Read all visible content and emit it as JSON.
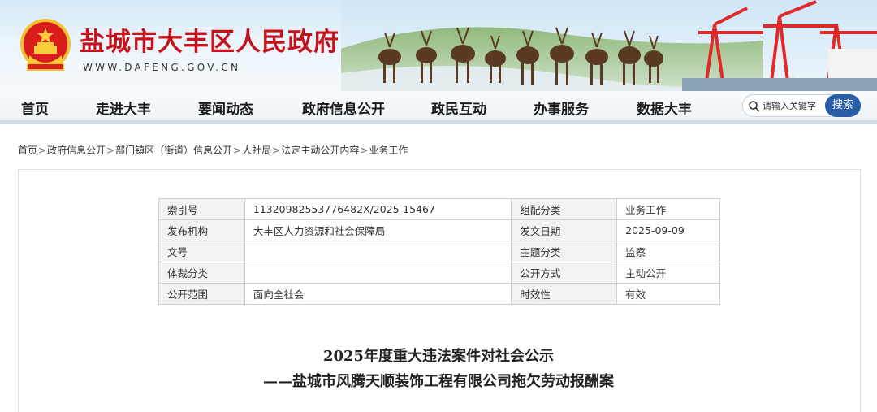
{
  "header": {
    "site_name": "盐城市大丰区人民政府",
    "site_url": "WWW.DAFENG.GOV.CN",
    "colors": {
      "brand_red": "#c6121a",
      "accent_blue": "#2a5ca8"
    }
  },
  "nav": {
    "items": [
      {
        "label": "首页"
      },
      {
        "label": "走进大丰"
      },
      {
        "label": "要闻动态"
      },
      {
        "label": "政府信息公开"
      },
      {
        "label": "政民互动"
      },
      {
        "label": "办事服务"
      },
      {
        "label": "数据大丰"
      }
    ],
    "search": {
      "placeholder": "请输入关键字",
      "button_label": "搜索",
      "icon": "search-icon"
    }
  },
  "breadcrumb": {
    "items": [
      "首页",
      "政府信息公开",
      "部门镇区（街道）信息公开",
      "人社局",
      "法定主动公开内容",
      "业务工作"
    ],
    "separator": ">"
  },
  "meta_table": {
    "rows": [
      {
        "k1": "索引号",
        "v1": "11320982553776482X/2025-15467",
        "k2": "组配分类",
        "v2": "业务工作"
      },
      {
        "k1": "发布机构",
        "v1": "大丰区人力资源和社会保障局",
        "k2": "发文日期",
        "v2": "2025-09-09"
      },
      {
        "k1": "文号",
        "v1": "",
        "k2": "主题分类",
        "v2": "监察"
      },
      {
        "k1": "体裁分类",
        "v1": "",
        "k2": "公开方式",
        "v2": "主动公开"
      },
      {
        "k1": "公开范围",
        "v1": "面向全社会",
        "k2": "时效性",
        "v2": "有效"
      }
    ]
  },
  "document": {
    "title_line1": "2025年度重大违法案件对社会公示",
    "title_line2": "——盐城市风腾天顺装饰工程有限公司拖欠劳动报酬案"
  }
}
